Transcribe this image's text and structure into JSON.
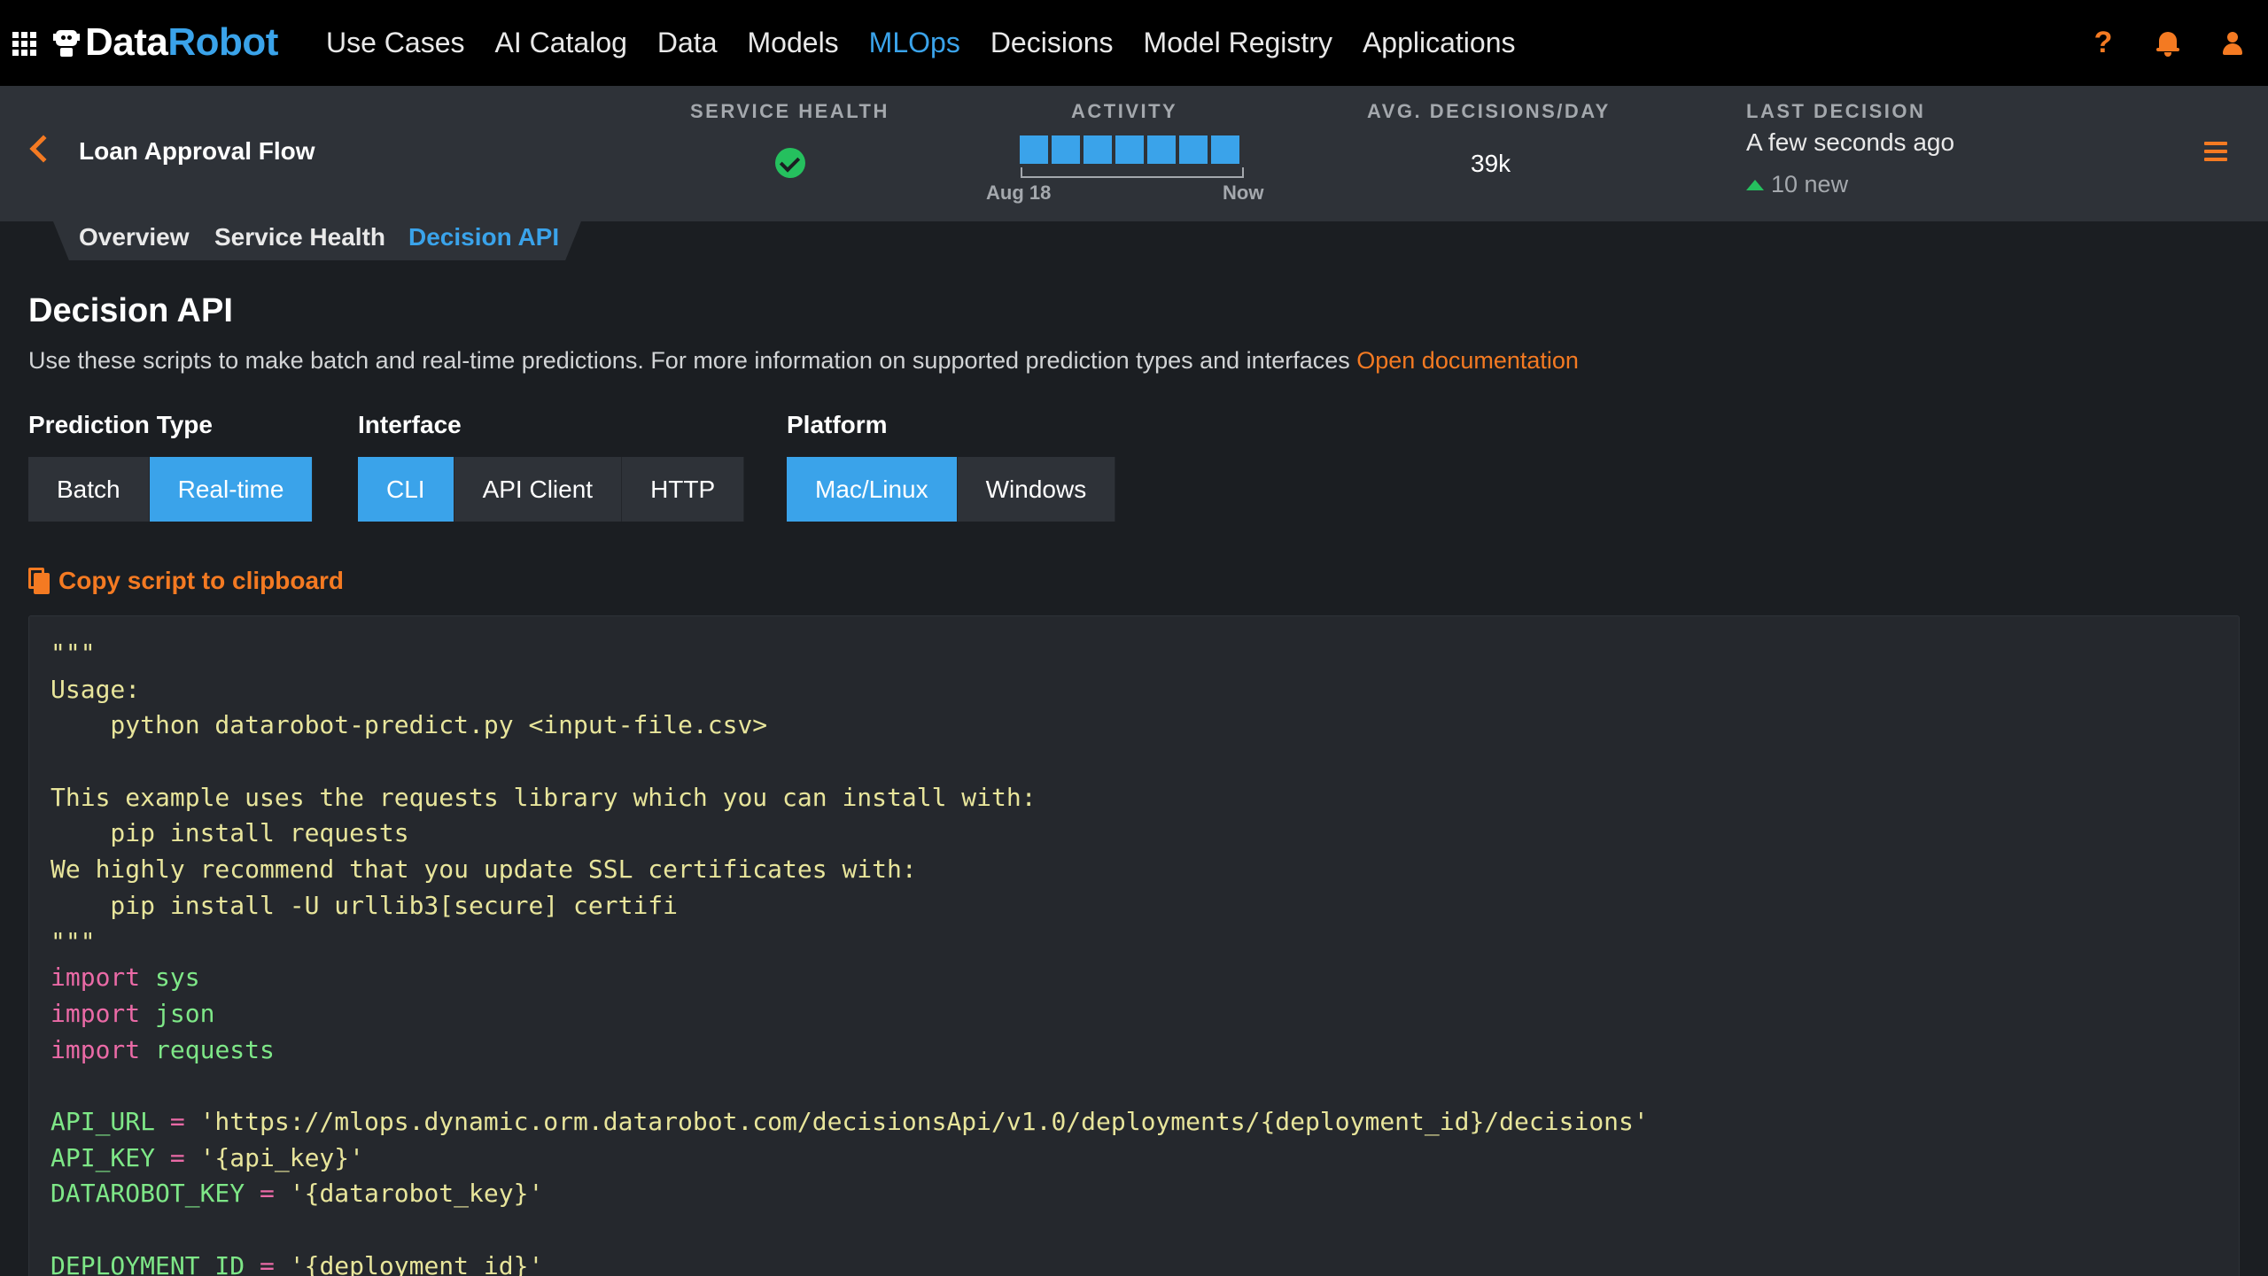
{
  "nav": {
    "logo_data": "Data",
    "logo_robot": "Robot",
    "items": [
      "Use Cases",
      "AI Catalog",
      "Data",
      "Models",
      "MLOps",
      "Decisions",
      "Model Registry",
      "Applications"
    ],
    "active": "MLOps",
    "icons": [
      "help-icon",
      "notification-bell-icon",
      "user-icon"
    ],
    "help_glyph": "?"
  },
  "deployment": {
    "name": "Loan Approval Flow",
    "service_health": {
      "label": "SERVICE HEALTH",
      "status": "healthy"
    },
    "activity": {
      "label": "ACTIVITY",
      "start_label": "Aug 18",
      "end_label": "Now",
      "bar_count": 7
    },
    "avg_decisions": {
      "label": "AVG. DECISIONS/DAY",
      "value": "39k"
    },
    "last_decision": {
      "label": "LAST DECISION",
      "value": "A few seconds ago",
      "new_count": "10 new"
    }
  },
  "tabs": [
    "Overview",
    "Service Health",
    "Decision API"
  ],
  "active_tab": "Decision API",
  "main": {
    "title": "Decision API",
    "description": "Use these scripts to make batch and real-time predictions. For more information on supported prediction types and interfaces ",
    "doc_link": "Open documentation",
    "prediction_type": {
      "label": "Prediction Type",
      "options": [
        "Batch",
        "Real-time"
      ],
      "selected": "Real-time"
    },
    "interface": {
      "label": "Interface",
      "options": [
        "CLI",
        "API Client",
        "HTTP"
      ],
      "selected": "CLI"
    },
    "platform": {
      "label": "Platform",
      "options": [
        "Mac/Linux",
        "Windows"
      ],
      "selected": "Mac/Linux"
    },
    "copy_label": "Copy script to clipboard",
    "code_lines": [
      [
        [
          "doc",
          "\"\"\""
        ]
      ],
      [
        [
          "doc",
          "Usage:"
        ]
      ],
      [
        [
          "doc",
          "    python datarobot-predict.py <input-file.csv>"
        ]
      ],
      [
        [
          "doc",
          ""
        ]
      ],
      [
        [
          "doc",
          "This example uses the requests library which you can install with:"
        ]
      ],
      [
        [
          "doc",
          "    pip install requests"
        ]
      ],
      [
        [
          "doc",
          "We highly recommend that you update SSL certificates with:"
        ]
      ],
      [
        [
          "doc",
          "    pip install -U urllib3[secure] certifi"
        ]
      ],
      [
        [
          "doc",
          "\"\"\""
        ]
      ],
      [
        [
          "kw",
          "import"
        ],
        [
          "id",
          " sys"
        ]
      ],
      [
        [
          "kw",
          "import"
        ],
        [
          "id",
          " json"
        ]
      ],
      [
        [
          "kw",
          "import"
        ],
        [
          "id",
          " requests"
        ]
      ],
      [
        [
          "doc",
          ""
        ]
      ],
      [
        [
          "id",
          "API_URL "
        ],
        [
          "op",
          "="
        ],
        [
          "str",
          " 'https://mlops.dynamic.orm.datarobot.com/decisionsApi/v1.0/deployments/{deployment_id}/decisions'"
        ]
      ],
      [
        [
          "id",
          "API_KEY "
        ],
        [
          "op",
          "="
        ],
        [
          "str",
          " '{api_key}'"
        ]
      ],
      [
        [
          "id",
          "DATAROBOT_KEY "
        ],
        [
          "op",
          "="
        ],
        [
          "str",
          " '{datarobot_key}'"
        ]
      ],
      [
        [
          "doc",
          ""
        ]
      ],
      [
        [
          "id",
          "DEPLOYMENT_ID "
        ],
        [
          "op",
          "="
        ],
        [
          "str",
          " '{deployment_id}'"
        ]
      ]
    ]
  },
  "colors": {
    "accent_blue": "#3aa3ea",
    "accent_orange": "#f47a22",
    "health_green": "#25c05e",
    "header_bg": "#2e3238",
    "page_bg": "#1b1e22"
  }
}
